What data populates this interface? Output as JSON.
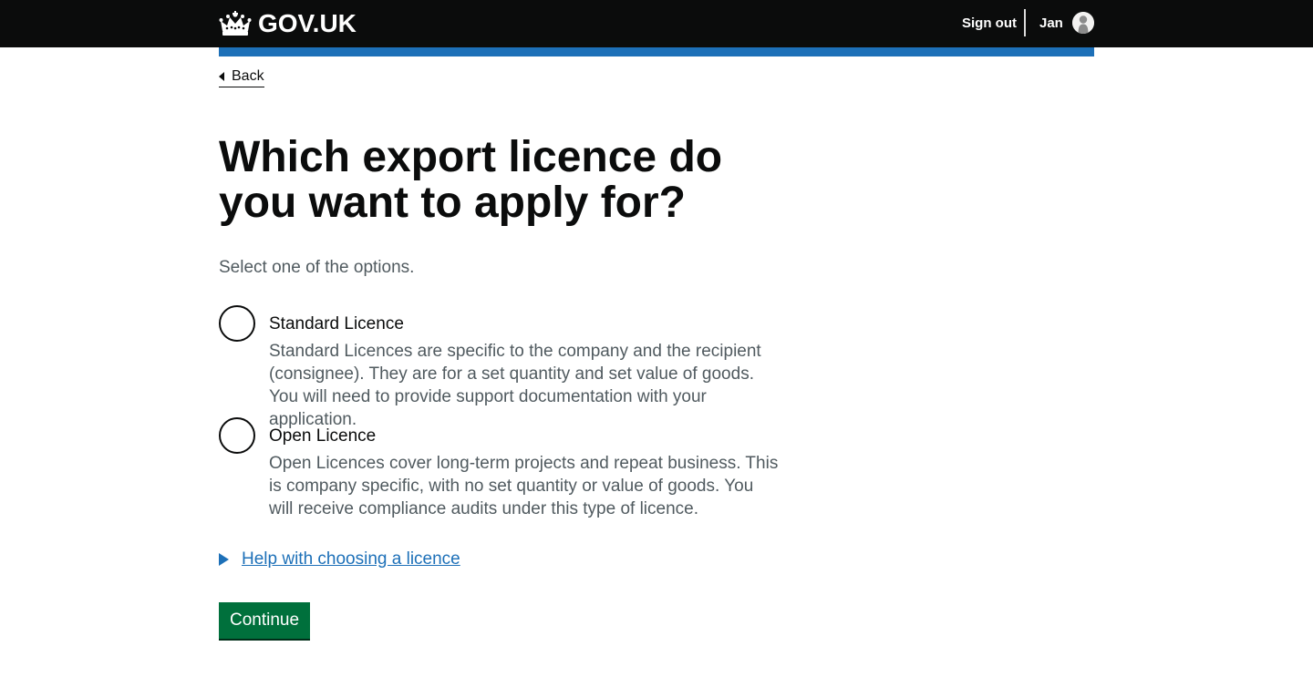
{
  "header": {
    "logo_text": "GOV.UK",
    "logo_icon": "crown-icon",
    "sign_out_label": "Sign out",
    "user_name": "Jan",
    "avatar_icon": "user-avatar-icon"
  },
  "colors": {
    "header_bg": "#0b0c0c",
    "accent_bar": "#1d70b8",
    "link": "#1d70b8",
    "button": "#00703c",
    "hint_text": "#505a5f"
  },
  "nav": {
    "back_label": "Back"
  },
  "main": {
    "title": "Which export licence do you want to apply for?",
    "hint": "Select one of the options.",
    "options": [
      {
        "label": "Standard Licence",
        "hint": "Standard Licences are specific to the company and the recipient (consignee). They are for a set quantity and set value of goods. You will need to provide support documentation with your application.",
        "selected": false
      },
      {
        "label": "Open Licence",
        "hint": "Open Licences cover long-term projects and repeat business. This is company specific, with no set quantity or value of goods. You will receive compliance audits under this type of licence.",
        "selected": false
      }
    ],
    "details_label": "Help with choosing a licence",
    "continue_label": "Continue"
  }
}
